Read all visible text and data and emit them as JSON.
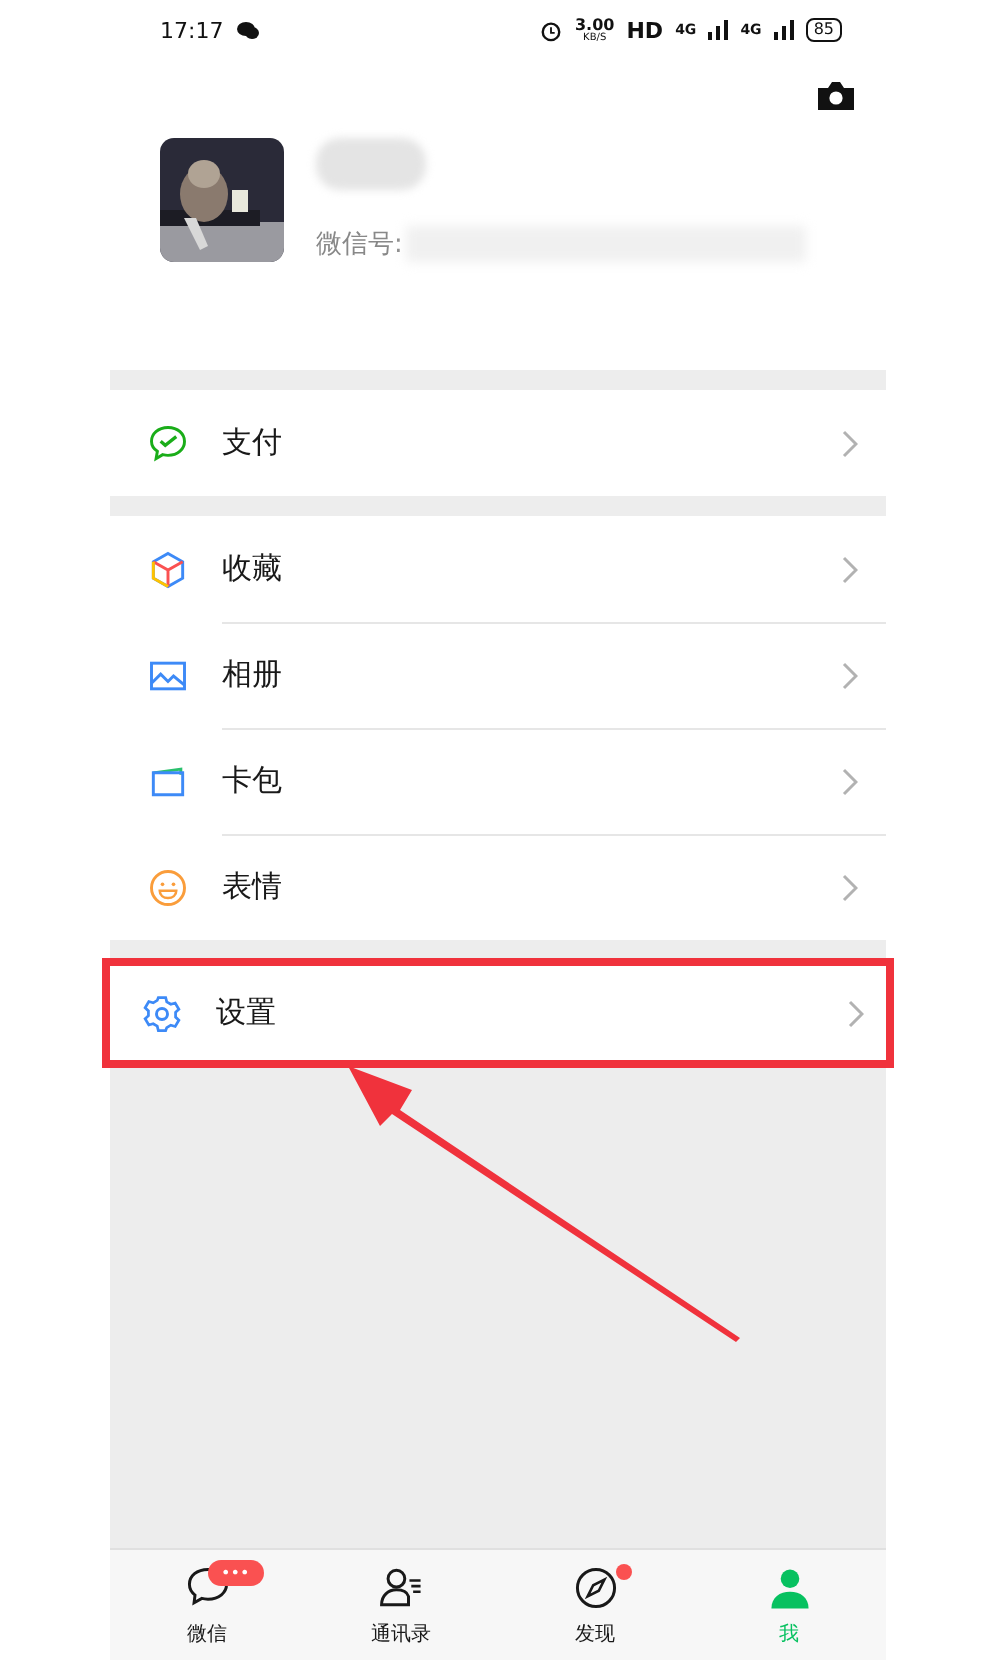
{
  "status_bar": {
    "time": "17:17",
    "speed": "3.00",
    "speed_unit": "KB/S",
    "hd": "HD",
    "net_1": "4G",
    "net_2": "4G",
    "battery": "85"
  },
  "profile": {
    "wechat_id_label": "微信号:"
  },
  "menu_groups": [
    {
      "items": [
        {
          "kind": "pay",
          "label": "支付",
          "highlighted": false
        }
      ]
    },
    {
      "items": [
        {
          "kind": "favorites",
          "label": "收藏",
          "highlighted": false
        },
        {
          "kind": "album",
          "label": "相册",
          "highlighted": false
        },
        {
          "kind": "cards",
          "label": "卡包",
          "highlighted": false
        },
        {
          "kind": "stickers",
          "label": "表情",
          "highlighted": false
        }
      ]
    },
    {
      "items": [
        {
          "kind": "settings",
          "label": "设置",
          "highlighted": true
        }
      ]
    }
  ],
  "tab_bar": [
    {
      "kind": "chats",
      "label": "微信",
      "selected": false,
      "badge": "•••",
      "dot": false
    },
    {
      "kind": "contacts",
      "label": "通讯录",
      "selected": false,
      "dot": false
    },
    {
      "kind": "discover",
      "label": "发现",
      "selected": false,
      "dot": true
    },
    {
      "kind": "me",
      "label": "我",
      "selected": true,
      "dot": false
    }
  ]
}
